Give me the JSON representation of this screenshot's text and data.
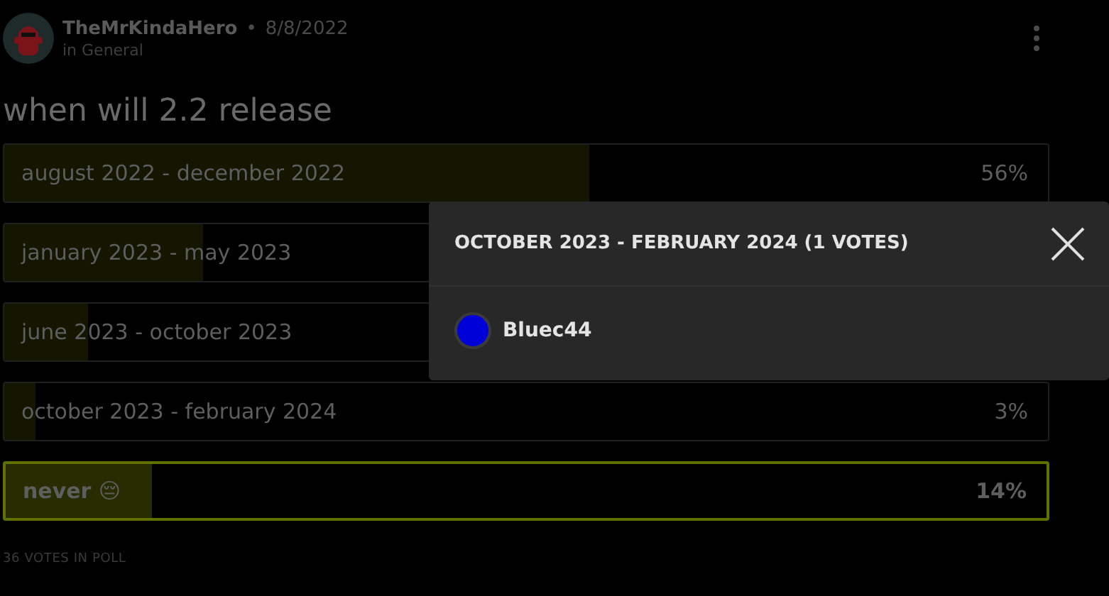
{
  "post": {
    "author": "TheMrKindaHero",
    "separator": "•",
    "date": "8/8/2022",
    "category": "in General"
  },
  "poll": {
    "question": "when will 2.2 release",
    "options": [
      {
        "label": "august 2022 - december 2022",
        "percent": "56%",
        "level": 0.56,
        "selected": false
      },
      {
        "label": "january 2023 - may 2023",
        "level": 0.19,
        "selected": false
      },
      {
        "label": "june 2023 - october 2023",
        "level": 0.08,
        "selected": false
      },
      {
        "label": "october 2023 - february 2024",
        "percent": "3%",
        "level": 0.03,
        "selected": false
      },
      {
        "label": "never 😔",
        "percent": "14%",
        "level": 0.14,
        "selected": true
      }
    ],
    "total": "36 VOTES IN POLL"
  },
  "voters_popup": {
    "title": "OCTOBER 2023 - FEBRUARY 2024 (1 VOTES)",
    "voters": [
      {
        "name": "Bluec44"
      }
    ]
  }
}
